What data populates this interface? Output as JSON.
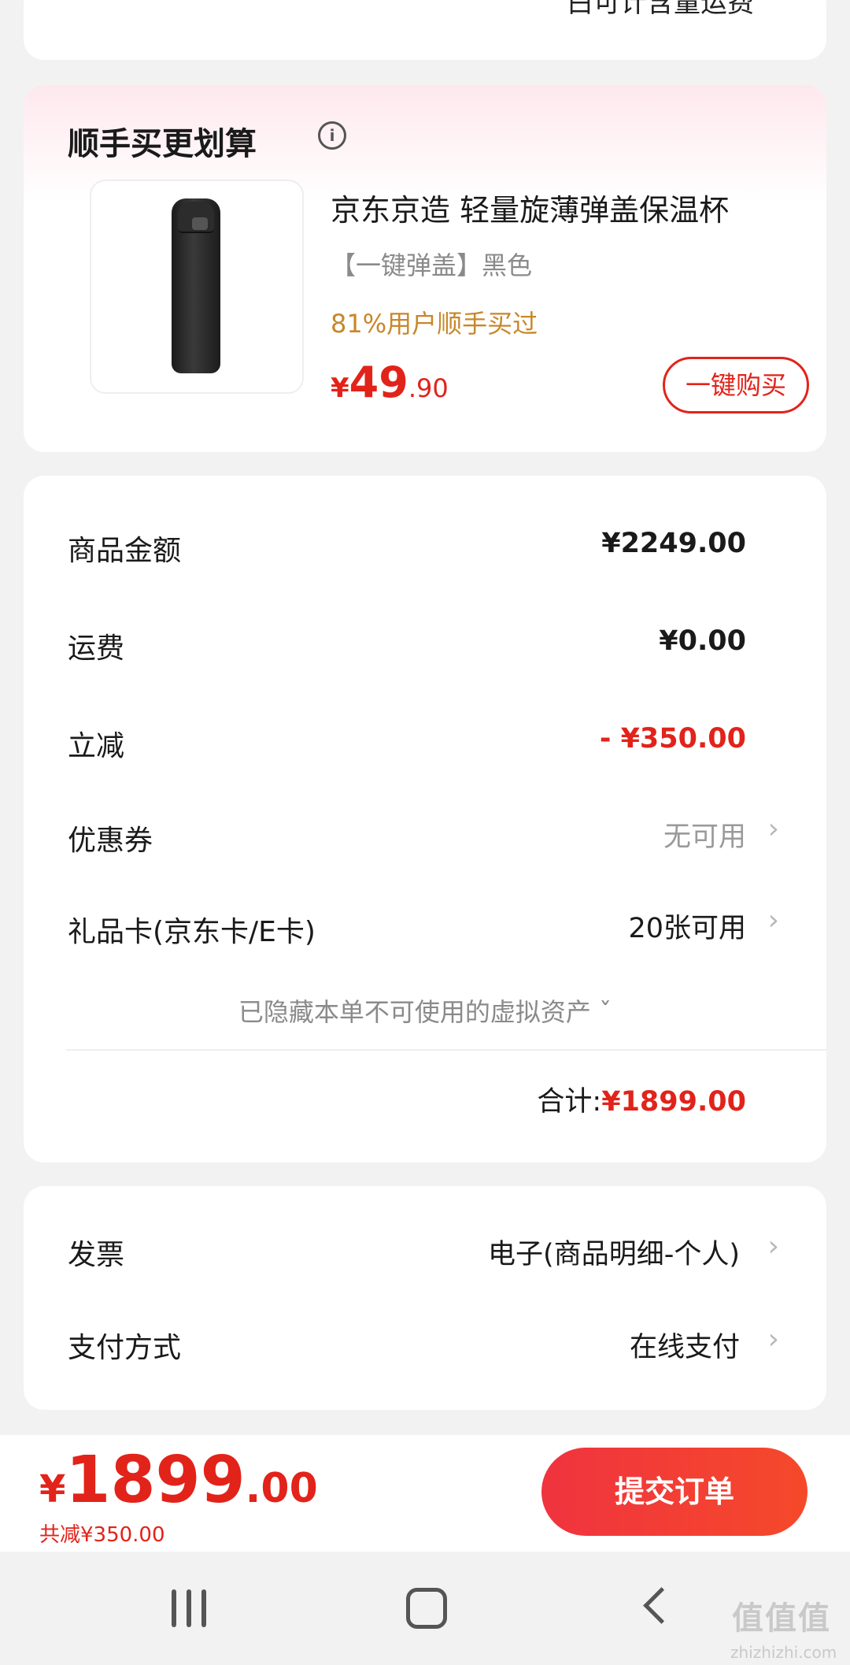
{
  "top_card": {
    "clipped_text": "白可计含量运费"
  },
  "upsell": {
    "title": "顺手买更划算",
    "product": {
      "name": "京东京造 轻量旋薄弹盖保温杯",
      "variant": "【一键弹盖】黑色",
      "promo": "81%用户顺手买过",
      "price_currency": "¥",
      "price_int": "49",
      "price_dec": ".90"
    },
    "buy_label": "一键购买"
  },
  "summary": {
    "rows": [
      {
        "label": "商品金额",
        "value": "¥2249.00"
      },
      {
        "label": "运费",
        "value": "¥0.00"
      },
      {
        "label": "立减",
        "value": "- ¥350.00"
      },
      {
        "label": "优惠券",
        "value": "无可用"
      },
      {
        "label": "礼品卡(京东卡/E卡)",
        "value": "20张可用"
      }
    ],
    "hidden_note": "已隐藏本单不可使用的虚拟资产 ˇ",
    "total_label": "合计:",
    "total_value": "¥1899.00"
  },
  "invoice_payment": {
    "rows": [
      {
        "label": "发票",
        "value": "电子(商品明细-个人)"
      },
      {
        "label": "支付方式",
        "value": "在线支付"
      }
    ]
  },
  "footer": {
    "price_currency": "¥",
    "price_int": "1899",
    "price_dec": ".00",
    "saving": "共减¥350.00",
    "submit_label": "提交订单"
  },
  "watermark": {
    "text": "值值值",
    "sub": "zhizhizhi.com"
  },
  "colors": {
    "accent": "#e2231a",
    "promo": "#c8872a",
    "background": "#f2f2f2"
  }
}
